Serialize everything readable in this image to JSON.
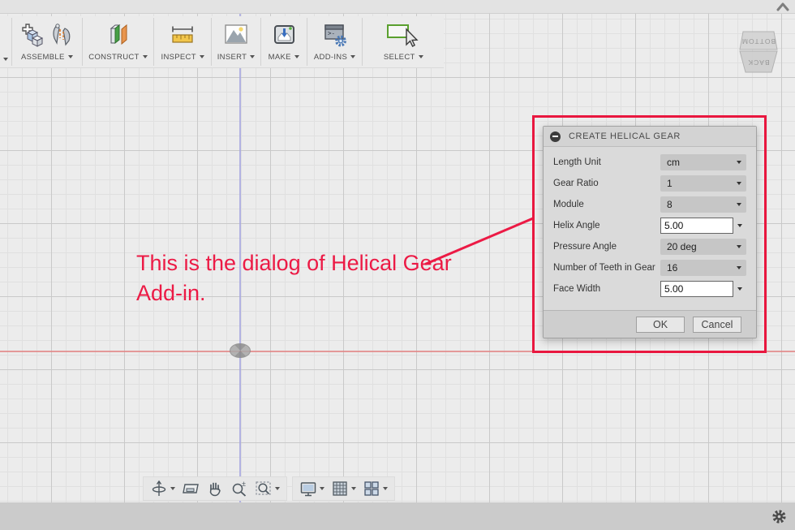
{
  "top_bar": {
    "collapse_icon": "chevron-up"
  },
  "toolbar": {
    "items": [
      {
        "label": "ASSEMBLE",
        "icons": [
          "new-component-icon",
          "joint-icon"
        ]
      },
      {
        "label": "CONSTRUCT",
        "icons": [
          "construction-plane-icon"
        ]
      },
      {
        "label": "INSPECT",
        "icons": [
          "measure-ruler-icon"
        ]
      },
      {
        "label": "INSERT",
        "icons": [
          "insert-image-icon"
        ]
      },
      {
        "label": "MAKE",
        "icons": [
          "3d-printer-icon"
        ]
      },
      {
        "label": "ADD-INS",
        "icons": [
          "scripts-addins-icon"
        ],
        "prompt_glyph": ">-"
      },
      {
        "label": "SELECT",
        "icons": [
          "select-box-cursor-icon"
        ]
      }
    ]
  },
  "viewcube": {
    "top_face": "BOTTOM",
    "front_face": "BACK"
  },
  "annotation": {
    "line1": "This is the dialog of Helical Gear",
    "line2": "Add-in.",
    "color": "#ec1a45"
  },
  "dialog": {
    "title": "CREATE HELICAL GEAR",
    "fields": [
      {
        "label": "Length Unit",
        "value": "cm",
        "type": "dropdown"
      },
      {
        "label": "Gear Ratio",
        "value": "1",
        "type": "dropdown"
      },
      {
        "label": "Module",
        "value": "8",
        "type": "dropdown"
      },
      {
        "label": "Helix Angle",
        "value": "5.00",
        "type": "input"
      },
      {
        "label": "Pressure Angle",
        "value": "20 deg",
        "type": "dropdown"
      },
      {
        "label": "Number of Teeth in Gear",
        "value": "16",
        "type": "dropdown"
      },
      {
        "label": "Face Width",
        "value": "5.00",
        "type": "input"
      }
    ],
    "ok_label": "OK",
    "cancel_label": "Cancel",
    "highlight_color": "#e9173f"
  },
  "nav_toolbar": {
    "icons": [
      "orbit-icon",
      "look-at-icon",
      "pan-hand-icon",
      "zoom-icon",
      "zoom-window-fit-icon",
      "display-settings-icon",
      "grid-layout-icon",
      "viewports-icon"
    ],
    "zoom_glyph": "±"
  },
  "status_bar": {
    "icons": [
      "settings-gear-icon"
    ]
  },
  "colors": {
    "canvas_bg": "#ececec",
    "grid_minor": "#e0e0e0",
    "grid_major": "#c9c9c9",
    "axis_vertical": "#a8a8e0",
    "axis_horizontal": "#e28585",
    "toolbar_bg": "#ebebeb",
    "dialog_bg": "#dadada",
    "combo_bg": "#c6c6c6",
    "statusbar_bg": "#cbcbcb",
    "annotation_red": "#ec1a45"
  }
}
